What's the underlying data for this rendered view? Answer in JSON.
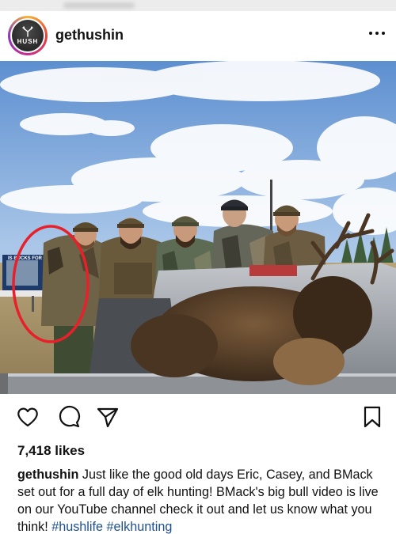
{
  "post": {
    "username": "gethushin",
    "avatar_text": "HUSH",
    "likes": "7,418 likes",
    "caption": "Just like the good old days Eric, Casey, and BMack set out for a full day of elk hunting! BMack's big bull video is live on our YouTube channel check it out and let us know what you think!",
    "hashtags": [
      "#hushlife",
      "#elkhunting"
    ],
    "billboard_text": "IS BUCKS FOR S"
  },
  "icons": {
    "more": "more-options-icon",
    "like": "heart-icon",
    "comment": "comment-icon",
    "share": "send-icon",
    "save": "bookmark-icon"
  },
  "colors": {
    "text": "#111111",
    "hashtag": "#1d4f91",
    "annotation_circle": "#e8202a"
  }
}
